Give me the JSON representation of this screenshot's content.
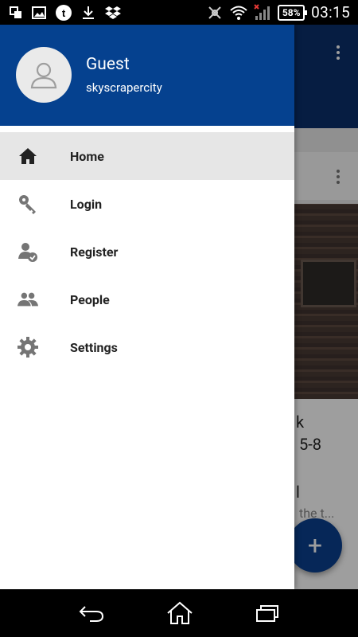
{
  "status_bar": {
    "time": "03:15",
    "battery": "58%",
    "left_icons": [
      "recent-apps-icon",
      "gallery-icon",
      "tumblr-icon",
      "download-icon",
      "dropbox-icon"
    ],
    "right_icons": [
      "nfc-disabled-icon",
      "wifi-icon",
      "signal-icon"
    ]
  },
  "drawer": {
    "user_name": "Guest",
    "user_sub": "skyscrapercity",
    "items": [
      {
        "label": "Home",
        "icon": "home-icon",
        "active": true
      },
      {
        "label": "Login",
        "icon": "key-icon",
        "active": false
      },
      {
        "label": "Register",
        "icon": "register-user-icon",
        "active": false
      },
      {
        "label": "People",
        "icon": "people-icon",
        "active": false
      },
      {
        "label": "Settings",
        "icon": "gear-icon",
        "active": false
      }
    ]
  },
  "background": {
    "text_fragment_1": "k",
    "text_fragment_2": "5-8",
    "text_fragment_3": "l",
    "text_fragment_4": "the t...",
    "fab_label": "+"
  },
  "colors": {
    "header_blue": "#05418f",
    "appbar_blue": "#0b2f6b",
    "active_item": "#e6e6e6"
  }
}
